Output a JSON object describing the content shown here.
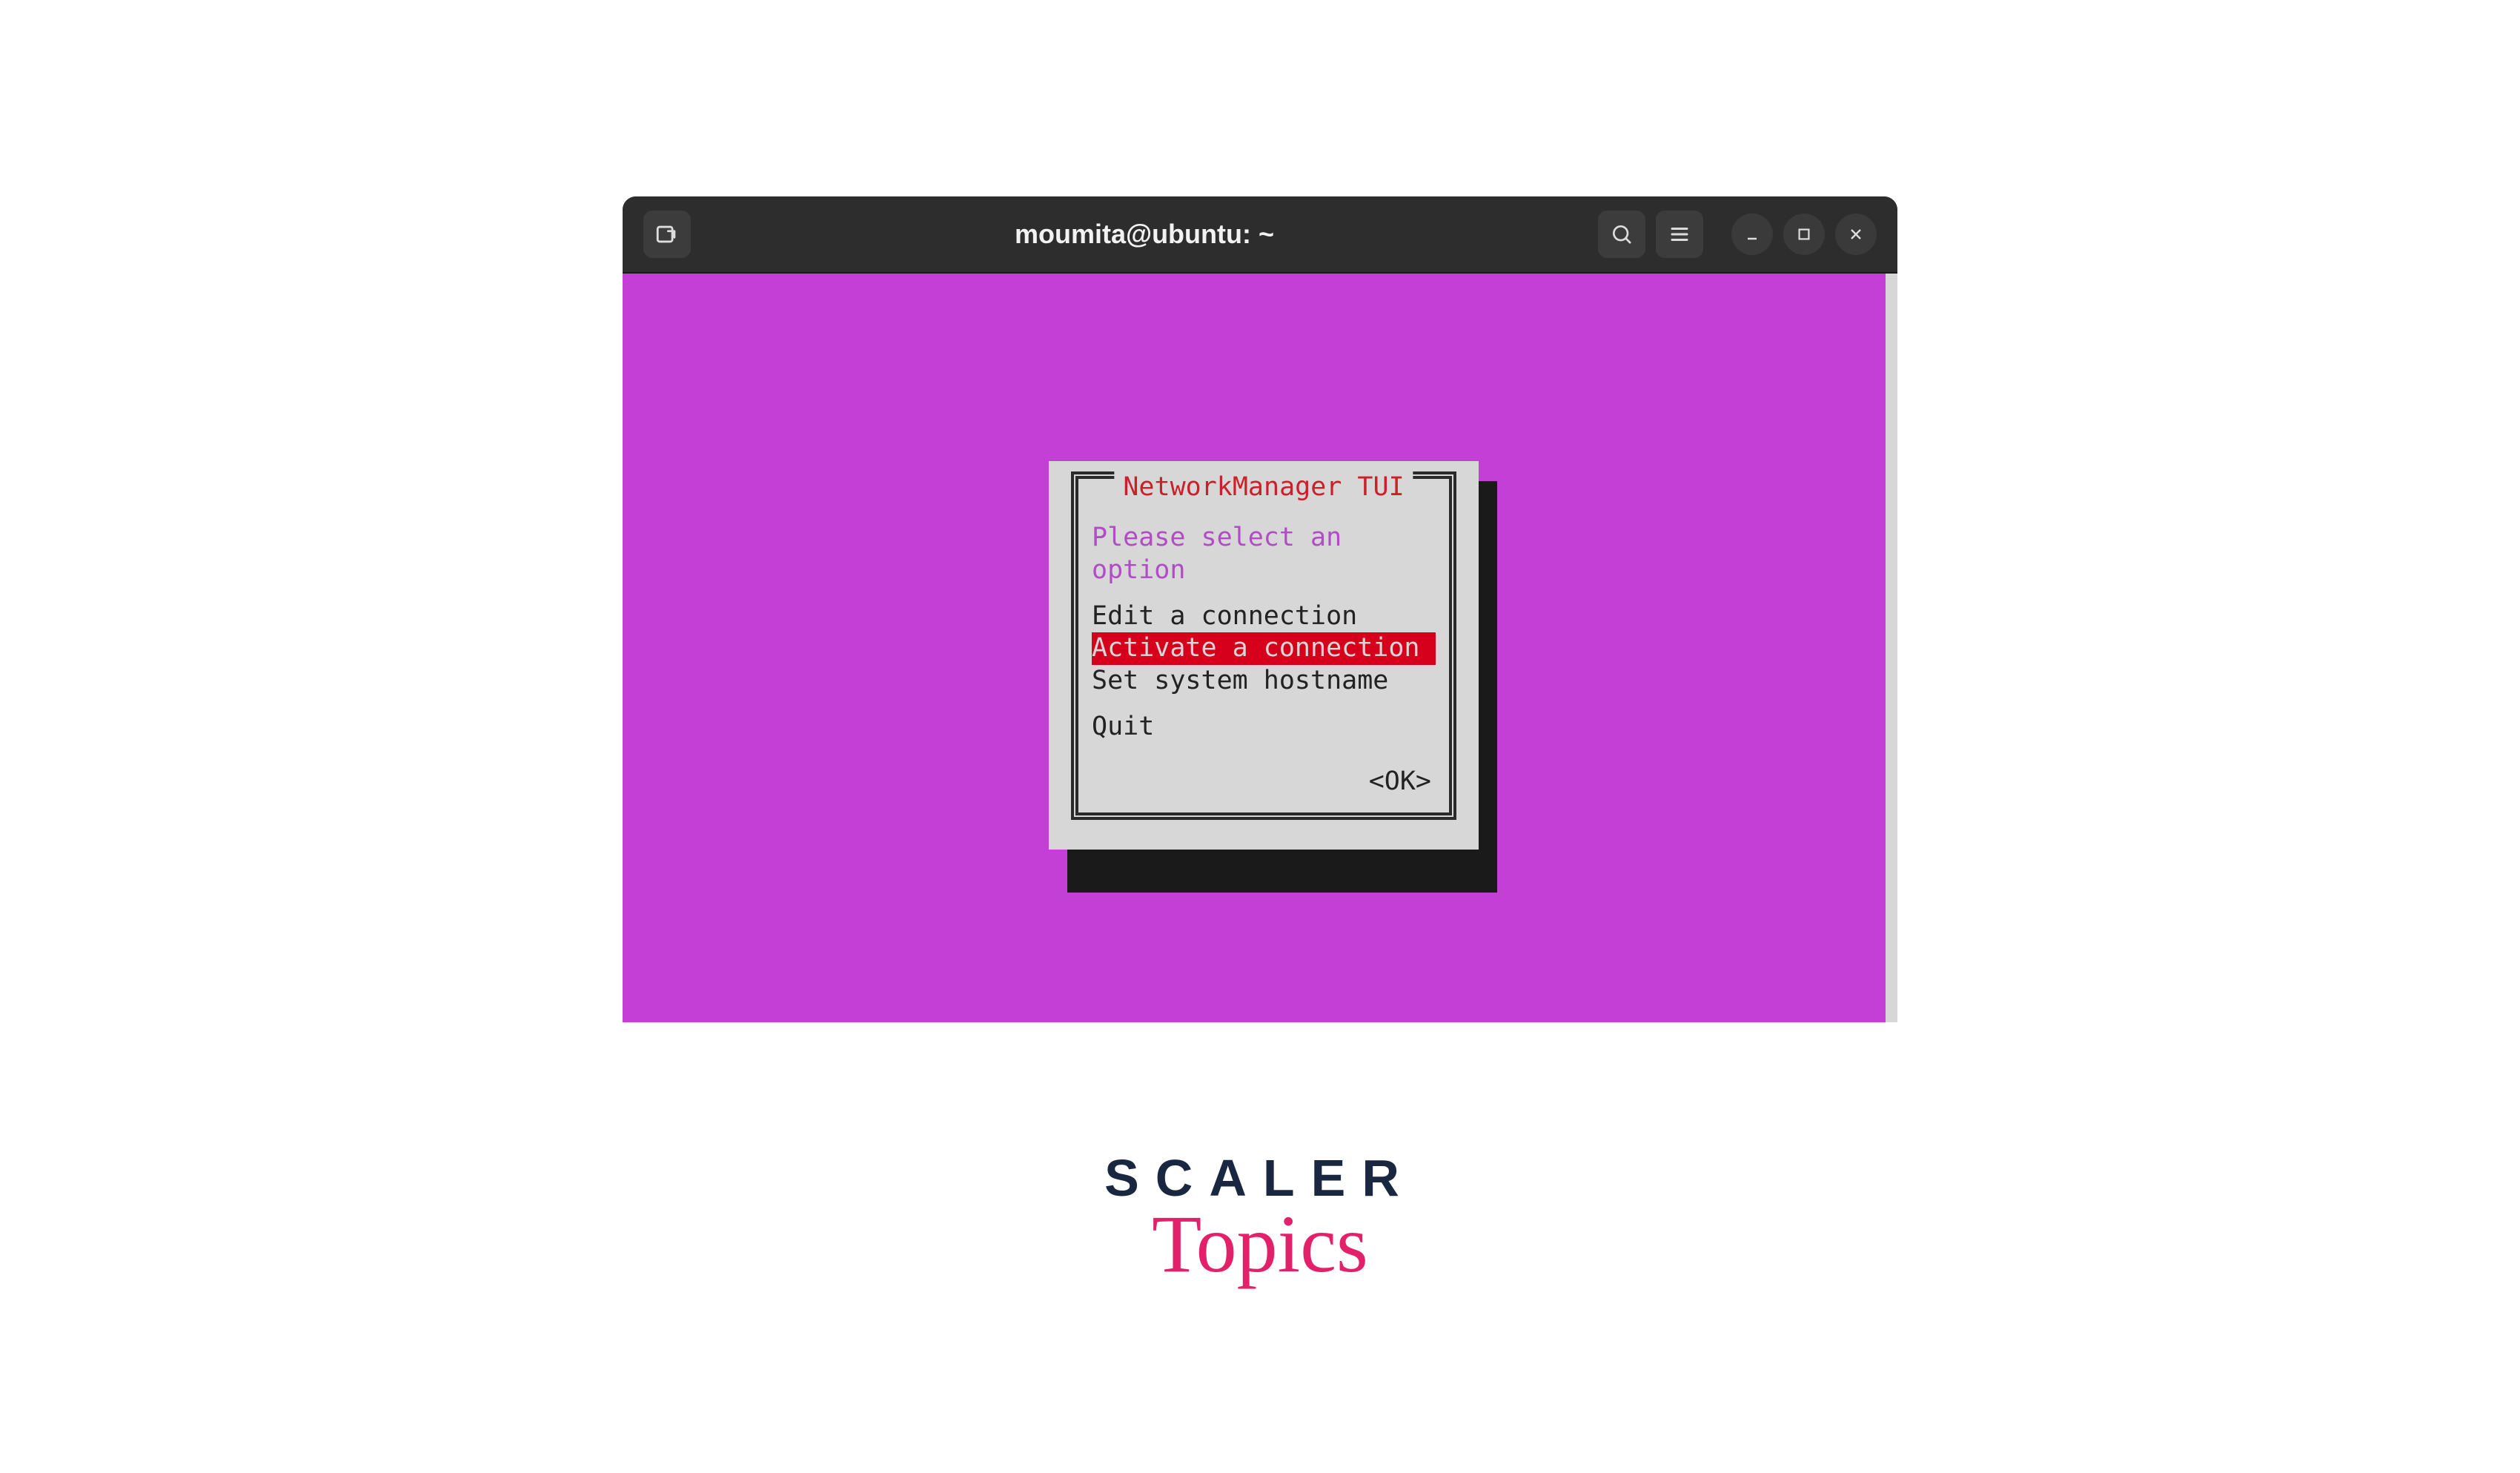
{
  "titlebar": {
    "title": "moumita@ubuntu: ~"
  },
  "tui": {
    "frame_title": "NetworkManager TUI",
    "prompt": "Please select an option",
    "items": {
      "edit": "Edit a connection",
      "activate": "Activate a connection",
      "hostname": "Set system hostname",
      "quit": "Quit"
    },
    "ok_label": "<OK>"
  },
  "branding": {
    "line1": "SCALER",
    "line2": "Topics"
  },
  "colors": {
    "terminal_bg": "#c33fd5",
    "dialog_bg": "#d7d7d7",
    "title_red": "#cc1f2a",
    "prompt_purple": "#b24cc6",
    "selection_red": "#d6001c"
  }
}
